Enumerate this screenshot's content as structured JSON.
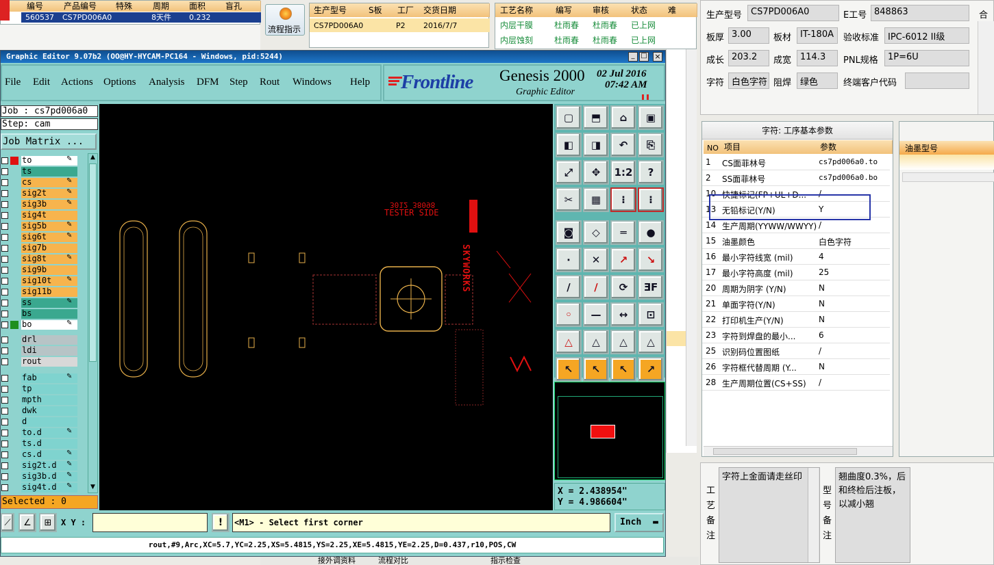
{
  "top_left_table": {
    "headers": [
      "编号",
      "产品编号",
      "特殊",
      "周期",
      "面积",
      "盲孔"
    ],
    "row": [
      "560537",
      "CS7PD006A0",
      "",
      "8天件",
      "0.232",
      ""
    ]
  },
  "flow_button": {
    "label": "流程指示"
  },
  "order_table": {
    "headers": [
      "生产型号",
      "S板",
      "工厂",
      "交货日期"
    ],
    "row": [
      "CS7PD006A0",
      "",
      "P2",
      "2016/7/7"
    ]
  },
  "process_table": {
    "headers": [
      "工艺名称",
      "编写",
      "审核",
      "状态",
      "难"
    ],
    "rows": [
      [
        "内层干膜",
        "杜雨春",
        "杜雨春",
        "已上网"
      ],
      [
        "内层蚀刻",
        "杜雨春",
        "杜雨春",
        "已上网"
      ]
    ]
  },
  "editor": {
    "title": "Graphic Editor 9.07b2 (OO@HY-HYCAM-PC164 - Windows, pid:5244)",
    "menu": [
      "File",
      "Edit",
      "Actions",
      "Options",
      "Analysis",
      "DFM",
      "Step",
      "Rout",
      "Windows",
      "Help"
    ],
    "brand": "Frontline",
    "product": "Genesis 2000",
    "subtitle": "Graphic Editor",
    "date": "02 Jul 2016",
    "time": "07:42 AM",
    "job": "Job : cs7pd006a0",
    "step": "Step: cam",
    "job_matrix": "Job Matrix ...",
    "layers_top": [
      {
        "name": "to",
        "color": "#ffffff",
        "pen": true
      },
      {
        "name": "ts",
        "color": "#3aa88f",
        "pen": false
      },
      {
        "name": "cs",
        "color": "#f7b44d",
        "pen": true
      },
      {
        "name": "sig2t",
        "color": "#f7b44d",
        "pen": true
      },
      {
        "name": "sig3b",
        "color": "#f7b44d",
        "pen": true
      },
      {
        "name": "sig4t",
        "color": "#f7b44d",
        "pen": false
      },
      {
        "name": "sig5b",
        "color": "#f7b44d",
        "pen": true
      },
      {
        "name": "sig6t",
        "color": "#f7b44d",
        "pen": true
      },
      {
        "name": "sig7b",
        "color": "#f7b44d",
        "pen": false
      },
      {
        "name": "sig8t",
        "color": "#f7b44d",
        "pen": true
      },
      {
        "name": "sig9b",
        "color": "#f7b44d",
        "pen": false
      },
      {
        "name": "sig10t",
        "color": "#f7b44d",
        "pen": true
      },
      {
        "name": "sig11b",
        "color": "#f7b44d",
        "pen": false
      },
      {
        "name": "ss",
        "color": "#3aa88f",
        "pen": true
      },
      {
        "name": "bs",
        "color": "#3aa88f",
        "pen": false
      },
      {
        "name": "bo",
        "color": "#ffffff",
        "pen": true
      }
    ],
    "layers_mid": [
      {
        "name": "drl",
        "color": "#b7c4c6",
        "pen": false
      },
      {
        "name": "ldi",
        "color": "#b7c4c6",
        "pen": false
      },
      {
        "name": "rout",
        "color": "#d8d8d8",
        "pen": false
      }
    ],
    "layers_bottom": [
      {
        "name": "fab",
        "color": "#7fd3cf",
        "pen": true
      },
      {
        "name": "tp",
        "color": "#7fd3cf",
        "pen": false
      },
      {
        "name": "mpth",
        "color": "#7fd3cf",
        "pen": false
      },
      {
        "name": "dwk",
        "color": "#7fd3cf",
        "pen": false
      },
      {
        "name": "d",
        "color": "#7fd3cf",
        "pen": false
      },
      {
        "name": "to.d",
        "color": "#7fd3cf",
        "pen": true
      },
      {
        "name": "ts.d",
        "color": "#7fd3cf",
        "pen": false
      },
      {
        "name": "cs.d",
        "color": "#7fd3cf",
        "pen": true
      },
      {
        "name": "sig2t.d",
        "color": "#7fd3cf",
        "pen": true
      },
      {
        "name": "sig3b.d",
        "color": "#7fd3cf",
        "pen": true
      },
      {
        "name": "sig4t.d",
        "color": "#7fd3cf",
        "pen": true
      }
    ],
    "selected": "Selected : 0",
    "coord_x": "X = 2.438954\"",
    "coord_y": "Y = 4.986604\"",
    "xy_label": "X Y :",
    "prompt": "<M1> - Select first corner",
    "units": "Inch",
    "status": "rout,#9,Arc,XC=5.7,YC=2.25,XS=5.4815,YS=2.25,XE=5.4815,YE=2.25,D=0.437,r10,POS,CW",
    "canvas_text": {
      "tester_side": "TESTER SIDE",
      "code": "3012 38098",
      "skyworks": "SKYWORKS"
    }
  },
  "info": {
    "row1": [
      {
        "label": "生产型号",
        "value": "CS7PD006A0"
      },
      {
        "label": "E工号",
        "value": "848863"
      }
    ],
    "row2": [
      {
        "label": "板厚",
        "value": "3.00"
      },
      {
        "label": "板材",
        "value": "IT-180A"
      },
      {
        "label": "验收标准",
        "value": "IPC-6012 II级"
      }
    ],
    "row3": [
      {
        "label": "成长",
        "value": "203.2"
      },
      {
        "label": "成宽",
        "value": "114.3"
      },
      {
        "label": "PNL规格",
        "value": "1P=6U"
      }
    ],
    "row4": [
      {
        "label": "字符",
        "value": "白色字符"
      },
      {
        "label": "阻焊",
        "value": "绿色"
      },
      {
        "label": "终端客户代码",
        "value": ""
      }
    ],
    "extra_label": "合拼"
  },
  "params": {
    "title": "字符: 工序基本参数",
    "headers": [
      "NO",
      "项目",
      "参数"
    ],
    "rows": [
      [
        "1",
        "CS面菲林号",
        "cs7pd006a0.to"
      ],
      [
        "2",
        "SS面菲林号",
        "cs7pd006a0.bo"
      ],
      [
        "10",
        "快捷标记(FP+UL+D...",
        "/"
      ],
      [
        "13",
        "无铅标记(Y/N)",
        "Y"
      ],
      [
        "14",
        "生产周期(YYWW/WWYY)",
        "/"
      ],
      [
        "15",
        "油墨颜色",
        "白色字符"
      ],
      [
        "16",
        "最小字符线宽 (mil)",
        "4"
      ],
      [
        "17",
        "最小字符高度 (mil)",
        "25"
      ],
      [
        "20",
        "周期为阴字 (Y/N)",
        "N"
      ],
      [
        "21",
        "单面字符(Y/N)",
        "N"
      ],
      [
        "22",
        "打印机生产(Y/N)",
        "N"
      ],
      [
        "23",
        "字符到焊盘的最小...",
        "6"
      ],
      [
        "25",
        "识别码位置图纸",
        "/"
      ],
      [
        "26",
        "字符框代替周期 (Y...",
        "N"
      ],
      [
        "28",
        "生产周期位置(CS+SS)",
        "/"
      ]
    ]
  },
  "ink_panel": {
    "header": "油墨型号"
  },
  "notes": {
    "process_label": "工艺备注",
    "process_text": "字符上金面请走丝印",
    "model_label": "型号备注",
    "model_text": "翘曲度0.3%，后和终检后注板，以减小翘"
  },
  "bottom_tabs": [
    "接外调资料",
    "流程对比",
    "",
    "指示检查"
  ]
}
